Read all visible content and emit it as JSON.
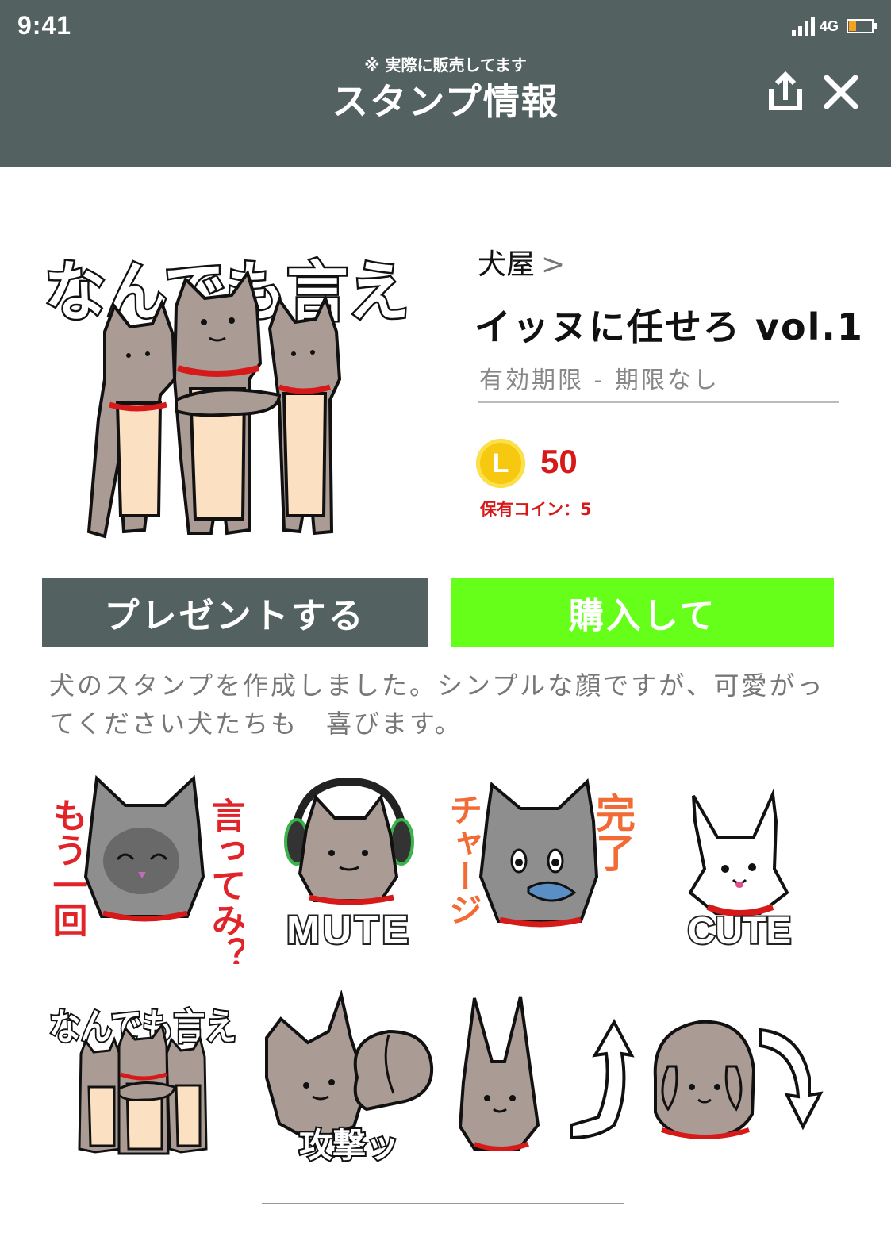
{
  "status_bar": {
    "time": "9:41",
    "network": "4G"
  },
  "header": {
    "notice": "※ 実際に販売してます",
    "title": "スタンプ情報",
    "share_icon": "share-icon",
    "close_icon": "close-icon"
  },
  "sticker": {
    "main_caption": "なんでも言え",
    "author": "犬屋",
    "author_chevron": ">",
    "name": "イッヌに任せろ vol.1",
    "expiry": "有効期限 - 期限なし",
    "coin_symbol": "L",
    "price": "50",
    "owned_coins": "保有コイン：5"
  },
  "buttons": {
    "gift": "プレゼントする",
    "buy": "購入して"
  },
  "description": "犬のスタンプを作成しました。シンプルな顔ですが、可愛がってください犬たちも　喜びます。",
  "thumbnails": {
    "t1": {
      "left": "もう一回",
      "right": "言ってみ？"
    },
    "t2": {
      "caption": "MUTE"
    },
    "t3": {
      "left": "チャージ",
      "right": "完了"
    },
    "t4": {
      "caption": "CUTE"
    },
    "t5": {
      "caption": "なんでも言え"
    },
    "t6": {
      "caption": "攻撃ッ"
    }
  },
  "colors": {
    "header": "#536261",
    "buy": "#66ff19",
    "gift": "#536261",
    "price": "#d61a1a",
    "coin": "#f6c80f"
  }
}
